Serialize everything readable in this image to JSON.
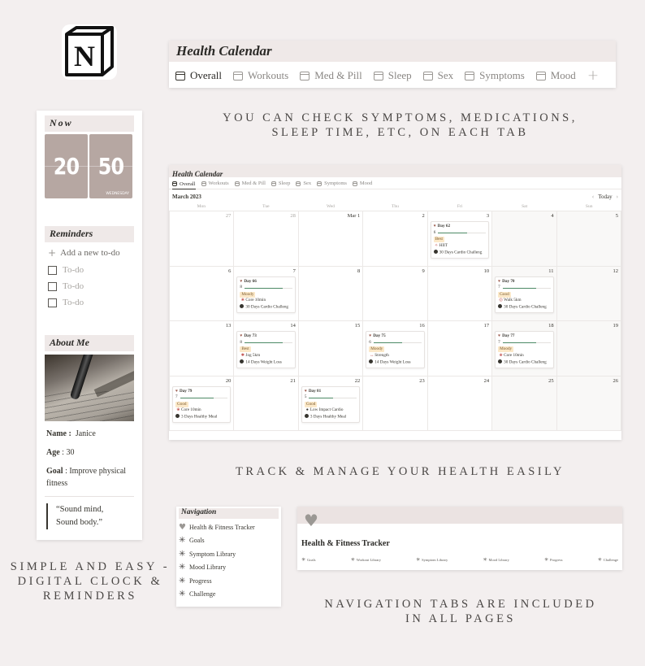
{
  "logo": {
    "letter": "N",
    "name": "Notion"
  },
  "top_tabbar": {
    "title": "Health Calendar",
    "tabs": [
      {
        "label": "Overall",
        "active": true
      },
      {
        "label": "Workouts",
        "active": false
      },
      {
        "label": "Med & Pill",
        "active": false
      },
      {
        "label": "Sleep",
        "active": false
      },
      {
        "label": "Sex",
        "active": false
      },
      {
        "label": "Symptoms",
        "active": false
      },
      {
        "label": "Mood",
        "active": false
      }
    ],
    "add_icon": "+"
  },
  "captions": {
    "tabs": "You can check symptoms, medications, sleep time, etc, on each tab",
    "tabs_line1": "You can check symptoms, medications,",
    "tabs_line2": "sleep time, etc, on each tab",
    "track": "Track & manage your health easily",
    "clock_line1": "Simple and easy -",
    "clock_line2": "digital clock &",
    "clock_line3": "reminders",
    "nav_line1": "Navigation tabs are included",
    "nav_line2": "in all pages"
  },
  "left_panel": {
    "now_heading": "Now",
    "clock": {
      "hour": "20",
      "minute": "50",
      "weekday": "Wednesday"
    },
    "reminders_heading": "Reminders",
    "add_todo": "Add a new to-do",
    "todos": [
      "To-do",
      "To-do",
      "To-do"
    ],
    "about_heading": "About Me",
    "name_label": "Name :",
    "name_value": "Janice",
    "age_label": "Age",
    "age_value": ": 30",
    "goal_label": "Goal",
    "goal_value": ": Improve physical fitness",
    "quote_line1": "“Sound mind,",
    "quote_line2": "Sound body.”"
  },
  "calendar": {
    "title": "Health Calendar",
    "tabs": [
      "Overall",
      "Workouts",
      "Med & Pill",
      "Sleep",
      "Sex",
      "Symptoms",
      "Mood"
    ],
    "month": "March 2023",
    "today_label": "Today",
    "weekdays": [
      "Mon",
      "Tue",
      "Wed",
      "Thu",
      "Fri",
      "Sat",
      "Sun"
    ],
    "weeks": [
      [
        {
          "label": "27",
          "other": true
        },
        {
          "label": "28",
          "other": true
        },
        {
          "label": "Mar 1"
        },
        {
          "label": "2"
        },
        {
          "label": "3",
          "entry": {
            "day": "Day 62",
            "score": 6,
            "progress": 0.6,
            "mood": "Best",
            "activity_icon": "hiit",
            "activity": "HIIT",
            "challenge": "30 Days Cardio Challeng"
          }
        },
        {
          "label": "4",
          "weekend": true
        },
        {
          "label": "5",
          "weekend": true
        }
      ],
      [
        {
          "label": "6"
        },
        {
          "label": "7",
          "entry": {
            "day": "Day 66",
            "score": 8,
            "progress": 0.8,
            "mood": "Moody",
            "activity_icon": "core",
            "activity": "Core 10min",
            "challenge": "30 Days Cardio Challeng"
          }
        },
        {
          "label": "8"
        },
        {
          "label": "9"
        },
        {
          "label": "10"
        },
        {
          "label": "11",
          "weekend": true,
          "entry": {
            "day": "Day 70",
            "score": 7,
            "progress": 0.7,
            "mood": "Good",
            "activity_icon": "walk",
            "activity": "Walk 5km",
            "challenge": "30 Days Cardio Challeng"
          }
        },
        {
          "label": "12",
          "weekend": true
        }
      ],
      [
        {
          "label": "13"
        },
        {
          "label": "14",
          "entry": {
            "day": "Day 73",
            "score": 8,
            "progress": 0.8,
            "mood": "Best",
            "activity_icon": "jog",
            "activity": "Jog 5km",
            "challenge": "14 Days Weight Loss"
          }
        },
        {
          "label": "15"
        },
        {
          "label": "16",
          "entry": {
            "day": "Day 75",
            "score": 6,
            "progress": 0.6,
            "mood": "Moody",
            "activity_icon": "strength",
            "activity": "Strength",
            "challenge": "14 Days Weight Loss"
          }
        },
        {
          "label": "17"
        },
        {
          "label": "18",
          "weekend": true,
          "entry": {
            "day": "Day 77",
            "score": 7,
            "progress": 0.7,
            "mood": "Moody",
            "activity_icon": "core",
            "activity": "Core 10min",
            "challenge": "30 Days Cardio Challeng"
          }
        },
        {
          "label": "19",
          "weekend": true
        }
      ],
      [
        {
          "label": "20",
          "entry": {
            "day": "Day 79",
            "score": 7,
            "progress": 0.7,
            "mood": "Good",
            "activity_icon": "core",
            "activity": "Core 10min",
            "challenge": "3 Days Healthy Meal"
          }
        },
        {
          "label": "21"
        },
        {
          "label": "22",
          "entry": {
            "day": "Day 81",
            "score": 5,
            "progress": 0.5,
            "mood": "Good",
            "activity_icon": "cardio",
            "activity": "Low Impact Cardio",
            "challenge": "3 Days Healthy Meal"
          }
        },
        {
          "label": "23"
        },
        {
          "label": "24"
        },
        {
          "label": "25",
          "weekend": true
        },
        {
          "label": "26",
          "weekend": true
        }
      ]
    ]
  },
  "navigation": {
    "heading": "Navigation",
    "items": [
      {
        "label": "Health & Fitness Tracker",
        "icon": "heart-link-icon"
      },
      {
        "label": "Goals",
        "icon": "asterisk-link-icon"
      },
      {
        "label": "Symptom Library",
        "icon": "asterisk-link-icon"
      },
      {
        "label": "Mood Library",
        "icon": "asterisk-link-icon"
      },
      {
        "label": "Progress",
        "icon": "asterisk-link-icon"
      },
      {
        "label": "Challenge",
        "icon": "asterisk-link-icon"
      }
    ]
  },
  "tracker": {
    "title": "Health & Fitness Tracker",
    "links": [
      "Goals",
      "Workout Library",
      "Symptom Library",
      "Mood Library",
      "Progress",
      "Challenge"
    ]
  },
  "colors": {
    "background": "#f3efef",
    "header_strip": "#efe9e8",
    "clock_tile": "#b6a7a2",
    "progress_fill": "#4d8a66",
    "mood_tag_bg": "#fbe8c8",
    "heart": "#9b9894"
  }
}
